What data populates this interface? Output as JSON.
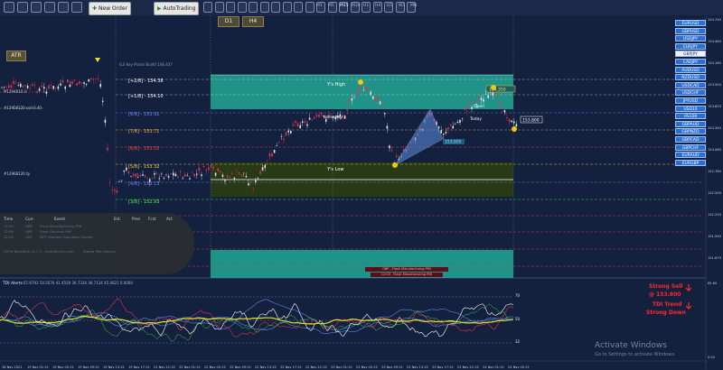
{
  "toolbar": {
    "new_order_label": "New Order",
    "autotrading_label": "AutoTrading",
    "icons": [
      "cursor-icon",
      "crosshair-icon",
      "vertical-line-icon",
      "horizontal-line-icon",
      "trendline-icon",
      "channel-icon",
      "fibo-icon",
      "text-icon",
      "arrows-icon",
      "new-chart-icon",
      "profiles-icon",
      "market-watch-icon",
      "navigator-icon",
      "terminal-icon",
      "tester-icon",
      "zoom-in-icon",
      "zoom-out-icon",
      "chart-bars-icon",
      "chart-candles-icon",
      "chart-line-icon",
      "autoscroll-icon",
      "shift-icon",
      "indicators-icon",
      "periods-icon",
      "templates-icon"
    ],
    "periods": [
      "M1",
      "M5",
      "M15",
      "M30",
      "H1",
      "H4",
      "D1",
      "W1",
      "MN"
    ],
    "active_period": "M15"
  },
  "chart_buttons": {
    "d1": "D1",
    "h4": "H4",
    "atr": "ATR"
  },
  "info_text": "[LS Key Points Build] 106.437",
  "symbol_list": [
    "EURUSD",
    "GBPUSD",
    "USDJPY",
    "EURJPY",
    "GBPJPY",
    "CADJPY",
    "AUDUSD",
    "NZDUSD",
    "USDCAD",
    "USDCHF",
    "JPYUSD",
    "USD10",
    "US100",
    "GBPAUD",
    "GBPNZD",
    "GBPCAD",
    "GBPCHF",
    "EURAUD",
    "EURGBP"
  ],
  "selected_symbol": "GBPJPY",
  "murray_levels": [
    {
      "label": "[+2/8] - 154.38",
      "color": "#ffffff"
    },
    {
      "label": "[+1/8] - 154.10",
      "color": "#ffffff"
    },
    {
      "label": "[8/8] - 153.91",
      "color": "#6f8cff"
    },
    {
      "label": "[7/8] - 153.71",
      "color": "#ffb347"
    },
    {
      "label": "[6/8] - 153.52",
      "color": "#ff4c4c"
    },
    {
      "label": "[5/8] - 153.32",
      "color": "#ffd84c"
    },
    {
      "label": "[4/8] - 153.13",
      "color": "#6f8cff"
    },
    {
      "label": "[3/8] - 152.93",
      "color": "#4cff4c"
    }
  ],
  "zones": {
    "yhigh": "Y's High",
    "ylow": "Y's Low",
    "yesterday": "Yesterday",
    "today": "Today",
    "open": "Open"
  },
  "left_labels": {
    "a": "#1294810 sl",
    "b": "#12958120 sell 0.40",
    "c": "#12968120 tp"
  },
  "price_tags": [
    "154.350",
    "153.605",
    "153.800"
  ],
  "price_axis": [
    "154.740",
    "154.460",
    "154.180",
    "153.900",
    "153.620",
    "153.340",
    "153.060",
    "152.780",
    "152.500",
    "152.220",
    "151.940",
    "151.670"
  ],
  "calendar": {
    "headers": [
      "Time",
      "Curr.",
      "Event",
      "Est.",
      "Prev",
      "Fcst",
      "Act"
    ],
    "rows": [
      {
        "time": "12:00",
        "curr": "GBP",
        "event": "Flash Manufacturing PMI"
      },
      {
        "time": "12:00",
        "curr": "GBP",
        "event": "Flash Services PMI"
      },
      {
        "time": "12:00",
        "curr": "GBP",
        "event": "MPC Member Saunders Speaks"
      }
    ],
    "footer": "FxPro NewsInfo v1.7.1 - forexfactory.com"
  },
  "tick_footer": "Stereo Pain Factory",
  "news_markers": [
    "GBP - Flash Manufacturing PMI",
    "12:00 - Flash Manufacturing PMI"
  ],
  "indicator": {
    "title": "TDI Alerts",
    "values": "67.6793 54.5676 41.4559 36.7334 36.7134 45.4621 0.0000",
    "scale": [
      "70",
      "50",
      "32"
    ],
    "axis": [
      "65.60",
      "0.00"
    ],
    "alert_line1": "Strong Sell",
    "alert_line2": "@ 153.800",
    "alert_line3": "TDI Trend",
    "alert_line4": "Strong Down"
  },
  "time_axis": [
    "18 Nov 2021",
    "19 Nov 01:15",
    "19 Nov 05:15",
    "19 Nov 09:15",
    "19 Nov 13:15",
    "19 Nov 17:15",
    "21 Nov 21:15",
    "22 Nov 01:15",
    "22 Nov 05:15",
    "22 Nov 09:15",
    "22 Nov 13:15",
    "22 Nov 17:15",
    "22 Nov 21:15",
    "23 Nov 01:15",
    "23 Nov 05:15",
    "23 Nov 09:15",
    "23 Nov 13:15",
    "23 Nov 17:15",
    "23 Nov 21:15",
    "24 Nov 01:15",
    "24 Nov 05:15"
  ],
  "watermark": {
    "line1": "Activate Windows",
    "line2": "Go to Settings to activate Windows."
  }
}
